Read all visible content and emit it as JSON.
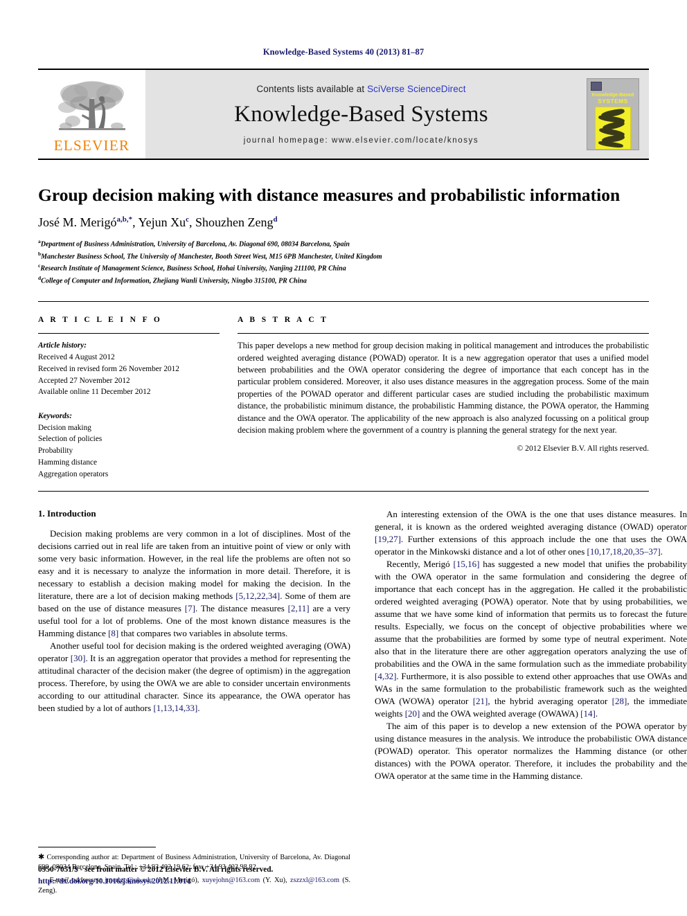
{
  "running_head": "Knowledge-Based Systems 40 (2013) 81–87",
  "masthead": {
    "contents_prefix": "Contents lists available at ",
    "contents_link": "SciVerse ScienceDirect",
    "journal_title": "Knowledge-Based Systems",
    "homepage": "journal homepage: www.elsevier.com/locate/knosys",
    "publisher_name": "ELSEVIER",
    "cover": {
      "line1": "Knowledge-Based",
      "line2": "SYSTEMS"
    }
  },
  "article": {
    "title": "Group decision making with distance measures and probabilistic information",
    "authors": [
      {
        "name": "José M. Merigó",
        "marks": "a,b,*"
      },
      {
        "name": "Yejun Xu",
        "marks": "c"
      },
      {
        "name": "Shouzhen Zeng",
        "marks": "d"
      }
    ],
    "affiliations": [
      {
        "mark": "a",
        "text": "Department of Business Administration, University of Barcelona, Av. Diagonal 690, 08034 Barcelona, Spain"
      },
      {
        "mark": "b",
        "text": "Manchester Business School, The University of Manchester, Booth Street West, M15 6PB Manchester, United Kingdom"
      },
      {
        "mark": "c",
        "text": "Research Institute of Management Science, Business School, Hohai University, Nanjing 211100, PR China"
      },
      {
        "mark": "d",
        "text": "College of Computer and Information, Zhejiang Wanli University, Ningbo 315100, PR China"
      }
    ]
  },
  "info": {
    "heading": "A R T I C L E  I N F O",
    "history_label": "Article history:",
    "history": [
      "Received 4 August 2012",
      "Received in revised form 26 November 2012",
      "Accepted 27 November 2012",
      "Available online 11 December 2012"
    ],
    "keywords_label": "Keywords:",
    "keywords": [
      "Decision making",
      "Selection of policies",
      "Probability",
      "Hamming distance",
      "Aggregation operators"
    ]
  },
  "abstract": {
    "heading": "A B S T R A C T",
    "text": "This paper develops a new method for group decision making in political management and introduces the probabilistic ordered weighted averaging distance (POWAD) operator. It is a new aggregation operator that uses a unified model between probabilities and the OWA operator considering the degree of importance that each concept has in the particular problem considered. Moreover, it also uses distance measures in the aggregation process. Some of the main properties of the POWAD operator and different particular cases are studied including the probabilistic maximum distance, the probabilistic minimum distance, the probabilistic Hamming distance, the POWA operator, the Hamming distance and the OWA operator. The applicability of the new approach is also analyzed focussing on a political group decision making problem where the government of a country is planning the general strategy for the next year.",
    "copyright": "© 2012 Elsevier B.V. All rights reserved."
  },
  "body": {
    "section_title": "1. Introduction",
    "left_paragraphs": [
      {
        "parts": [
          {
            "t": "Decision making problems are very common in a lot of disciplines. Most of the decisions carried out in real life are taken from an intuitive point of view or only with some very basic information. However, in the real life the problems are often not so easy and it is necessary to analyze the information in more detail. Therefore, it is necessary to establish a decision making model for making the decision. In the literature, there are a lot of decision making methods "
          },
          {
            "t": "[5,12,22,34]",
            "ref": true
          },
          {
            "t": ". Some of them are based on the use of distance measures "
          },
          {
            "t": "[7]",
            "ref": true
          },
          {
            "t": ". The distance measures "
          },
          {
            "t": "[2,11]",
            "ref": true
          },
          {
            "t": " are a very useful tool for a lot of problems. One of the most known distance measures is the Hamming distance "
          },
          {
            "t": "[8]",
            "ref": true
          },
          {
            "t": " that compares two variables in absolute terms."
          }
        ]
      },
      {
        "parts": [
          {
            "t": "Another useful tool for decision making is the ordered weighted averaging (OWA) operator "
          },
          {
            "t": "[30]",
            "ref": true
          },
          {
            "t": ". It is an aggregation operator that provides a method for representing the attitudinal character of the decision maker (the degree of optimism) in the aggregation process. Therefore, by using the OWA we are able to consider uncertain environments according to our attitudinal character. Since its appearance, the OWA operator has been studied by a lot of authors "
          },
          {
            "t": "[1,13,14,33]",
            "ref": true
          },
          {
            "t": "."
          }
        ]
      }
    ],
    "right_paragraphs": [
      {
        "parts": [
          {
            "t": "An interesting extension of the OWA is the one that uses distance measures. In general, it is known as the ordered weighted averaging distance (OWAD) operator "
          },
          {
            "t": "[19,27]",
            "ref": true
          },
          {
            "t": ". Further extensions of this approach include the one that uses the OWA operator in the Minkowski distance and a lot of other ones "
          },
          {
            "t": "[10,17,18,20,35–37]",
            "ref": true
          },
          {
            "t": "."
          }
        ]
      },
      {
        "parts": [
          {
            "t": "Recently, Merigó "
          },
          {
            "t": "[15,16]",
            "ref": true
          },
          {
            "t": " has suggested a new model that unifies the probability with the OWA operator in the same formulation and considering the degree of importance that each concept has in the aggregation. He called it the probabilistic ordered weighted averaging (POWA) operator. Note that by using probabilities, we assume that we have some kind of information that permits us to forecast the future results. Especially, we focus on the concept of objective probabilities where we assume that the probabilities are formed by some type of neutral experiment. Note also that in the literature there are other aggregation operators analyzing the use of probabilities and the OWA in the same formulation such as the immediate probability "
          },
          {
            "t": "[4,32]",
            "ref": true
          },
          {
            "t": ". Furthermore, it is also possible to extend other approaches that use OWAs and WAs in the same formulation to the probabilistic framework such as the weighted OWA (WOWA) operator "
          },
          {
            "t": "[21]",
            "ref": true
          },
          {
            "t": ", the hybrid averaging operator "
          },
          {
            "t": "[28]",
            "ref": true
          },
          {
            "t": ", the immediate weights "
          },
          {
            "t": "[20]",
            "ref": true
          },
          {
            "t": " and the OWA weighted average (OWAWA) "
          },
          {
            "t": "[14]",
            "ref": true
          },
          {
            "t": "."
          }
        ]
      },
      {
        "parts": [
          {
            "t": "The aim of this paper is to develop a new extension of the POWA operator by using distance measures in the analysis. We introduce the probabilistic OWA distance (POWAD) operator. This operator normalizes the Hamming distance (or other distances) with the POWA operator. Therefore, it includes the probability and the OWA operator at the same time in the Hamming distance."
          }
        ]
      }
    ]
  },
  "footnotes": {
    "corresponding": "Corresponding author at: Department of Business Administration, University of Barcelona, Av. Diagonal 690, 08034 Barcelona, Spain. Tel.: +34 93 402 19 62; fax: +34 93 403 98 82.",
    "email_label": "E-mail addresses:",
    "emails": [
      {
        "address": "jmerigo@ub.edu",
        "who": "(J.M. Merigó)"
      },
      {
        "address": "xuyejohn@163.com",
        "who": "(Y. Xu)"
      },
      {
        "address": "zszzxl@163.com",
        "who": "(S. Zeng)"
      }
    ]
  },
  "footer": {
    "issn_line": "0950-7051/$ - see front matter © 2012 Elsevier B.V. All rights reserved.",
    "doi": "http://dx.doi.org/10.1016/j.knosys.2012.11.014"
  },
  "colors": {
    "link_blue": "#2b35c4",
    "ref_navy": "#18196b",
    "elsevier_orange": "#f08000",
    "masthead_gray": "#e3e3e3",
    "cover_yellow": "#f2ef2a"
  }
}
